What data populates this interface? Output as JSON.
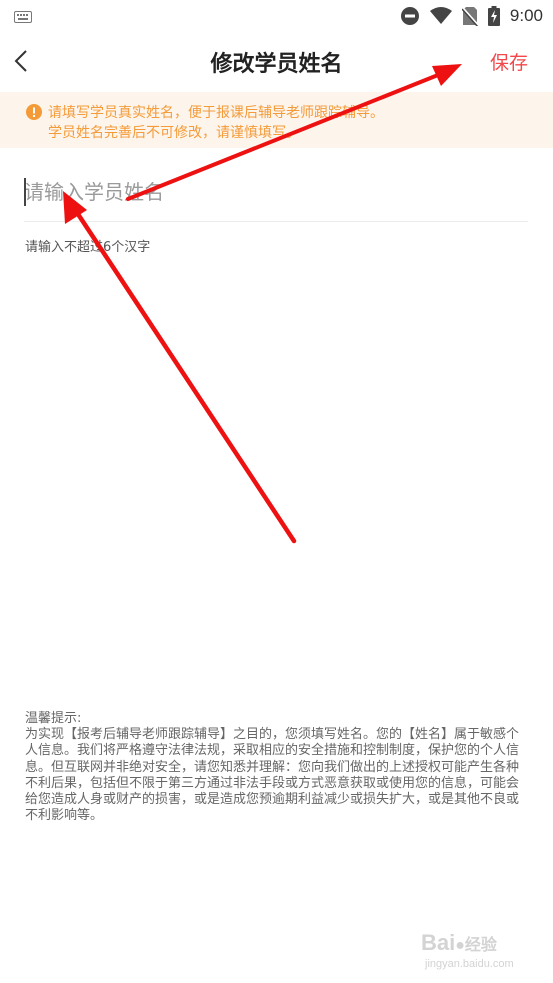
{
  "status_bar": {
    "time": "9:00",
    "icons": [
      "keyboard-icon",
      "do-not-disturb-icon",
      "wifi-icon",
      "no-sim-icon",
      "battery-charging-icon"
    ]
  },
  "header": {
    "title": "修改学员姓名",
    "back_icon": "chevron-left-icon",
    "save_label": "保存",
    "accent_color": "#f2484c"
  },
  "notice": {
    "icon": "warning-circle-icon",
    "line1": "请填写学员真实姓名，便于报课后辅导老师跟踪辅导。",
    "line2": "学员姓名完善后不可修改，请谨慎填写。",
    "color": "#f49b38",
    "background": "#fdf4ec"
  },
  "form": {
    "name_value": "",
    "name_placeholder": "请输入学员姓名",
    "hint": "请输入不超过6个汉字"
  },
  "tips": {
    "title": "温馨提示:",
    "body": "为实现【报考后辅导老师跟踪辅导】之目的，您须填写姓名。您的【姓名】属于敏感个人信息。我们将严格遵守法律法规，采取相应的安全措施和控制制度，保护您的个人信息。但互联网并非绝对安全，请您知悉并理解：您向我们做出的上述授权可能产生各种不利后果，包括但不限于第三方通过非法手段或方式恶意获取或使用您的信息，可能会给您造成人身或财产的损害，或是造成您预逾期利益减少或损失扩大，或是其他不良或不利影响等。"
  },
  "watermark": {
    "main": "Bai",
    "main_suffix": "经验",
    "sub": "jingyan.baidu.com"
  },
  "annotation_color": "#ee1111"
}
